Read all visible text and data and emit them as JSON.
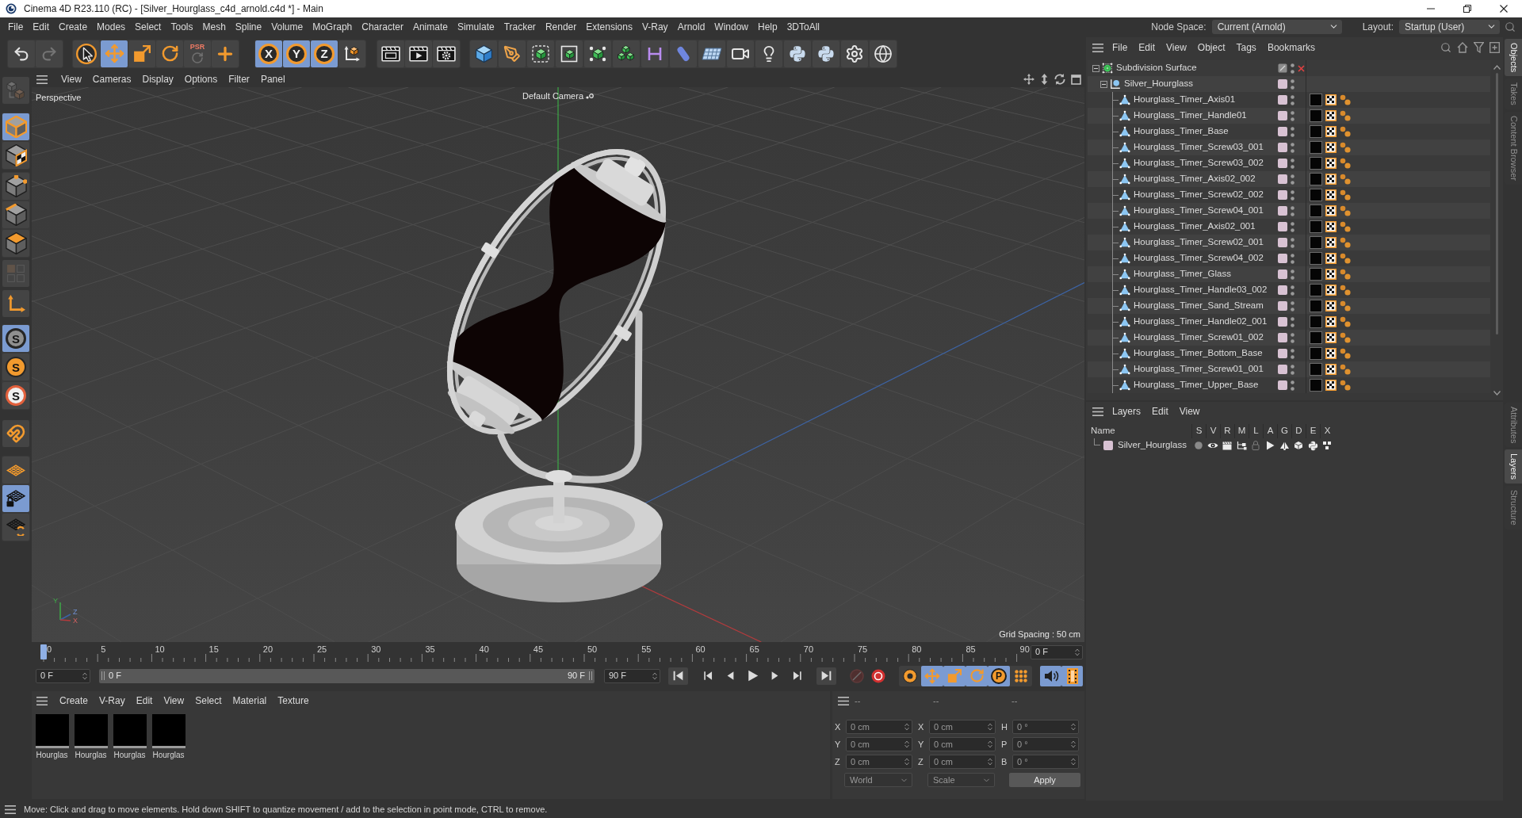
{
  "window": {
    "title": "Cinema 4D R23.110 (RC) - [Silver_Hourglass_c4d_arnold.c4d *] - Main"
  },
  "menu_bar": [
    "File",
    "Edit",
    "Create",
    "Modes",
    "Select",
    "Tools",
    "Mesh",
    "Spline",
    "Volume",
    "MoGraph",
    "Character",
    "Animate",
    "Simulate",
    "Tracker",
    "Render",
    "Extensions",
    "V-Ray",
    "Arnold",
    "Window",
    "Help",
    "3DToAll"
  ],
  "node_space": {
    "label": "Node Space:",
    "value": "Current (Arnold)"
  },
  "layout": {
    "label": "Layout:",
    "value": "Startup (User)"
  },
  "main_toolbar": [
    [
      {
        "active": false,
        "disabled": false
      },
      {
        "active": false,
        "disabled": true
      }
    ],
    [
      {
        "active": false,
        "disabled": false
      },
      {
        "active": true,
        "disabled": false
      },
      {
        "active": false,
        "disabled": false
      },
      {
        "active": false,
        "disabled": false
      },
      {
        "label": "PSR",
        "active": false,
        "disabled": true
      },
      {
        "active": false,
        "disabled": false
      }
    ],
    [
      {
        "label": "X",
        "active": true,
        "disabled": false
      },
      {
        "label": "Y",
        "active": true,
        "disabled": false
      },
      {
        "label": "Z",
        "active": true,
        "disabled": false
      },
      {
        "active": false,
        "disabled": false
      }
    ],
    [
      {
        "active": false,
        "disabled": false
      },
      {
        "active": false,
        "disabled": false
      },
      {
        "active": false,
        "disabled": false
      }
    ],
    [
      {
        "active": false,
        "disabled": false
      },
      {
        "active": false,
        "disabled": false
      },
      {
        "active": false,
        "disabled": false
      },
      {
        "active": false,
        "disabled": false
      },
      {
        "active": false,
        "disabled": false
      },
      {
        "active": false,
        "disabled": false
      },
      {
        "active": false,
        "disabled": false
      },
      {
        "active": false,
        "disabled": false
      },
      {
        "active": false,
        "disabled": false
      },
      {
        "active": false,
        "disabled": false
      },
      {
        "active": false,
        "disabled": false
      },
      {
        "active": false,
        "disabled": false
      },
      {
        "active": false,
        "disabled": false
      },
      {
        "active": false,
        "disabled": false
      },
      {
        "active": false,
        "disabled": false
      }
    ]
  ],
  "mode_toolbar": [
    [
      {
        "active": false,
        "disabled": true
      }
    ],
    [
      {
        "active": true,
        "disabled": false
      },
      {
        "active": false,
        "disabled": false
      }
    ],
    [
      {
        "active": false,
        "disabled": false
      },
      {
        "active": false,
        "disabled": false
      },
      {
        "active": false,
        "disabled": false
      }
    ],
    [
      {
        "active": false,
        "disabled": true
      }
    ],
    [
      {
        "active": false,
        "disabled": false
      }
    ],
    [
      {
        "label": "S",
        "active": true,
        "disabled": false
      },
      {
        "label": "S",
        "active": false,
        "disabled": false
      },
      {
        "label": "S",
        "active": false,
        "disabled": false
      }
    ],
    [
      {
        "active": false,
        "disabled": false
      }
    ],
    [
      {
        "active": false,
        "disabled": false
      },
      {
        "active": true,
        "disabled": false
      },
      {
        "active": false,
        "disabled": false
      }
    ]
  ],
  "viewport": {
    "menu": [
      "View",
      "Cameras",
      "Display",
      "Options",
      "Filter",
      "Panel"
    ],
    "view_name": "Perspective",
    "camera": "Default Camera",
    "grid_spacing": "Grid Spacing : 50 cm",
    "gizmo_labels": [
      "Y",
      "Z",
      "X"
    ]
  },
  "timeline": {
    "ruler_labels": [
      "0",
      "5",
      "10",
      "15",
      "20",
      "25",
      "30",
      "35",
      "40",
      "45",
      "50",
      "55",
      "60",
      "65",
      "70",
      "75",
      "80",
      "85",
      "90"
    ],
    "playhead": {
      "level": 0
    },
    "current_frame": "0 F",
    "start": "0 F",
    "range_start": "0 F",
    "range_end": "90 F",
    "end": "90 F",
    "record": [
      {
        "disabled": true
      },
      {
        "disabled": false
      }
    ],
    "key_tools": [
      {
        "active": false
      },
      {
        "active": true
      },
      {
        "active": true
      },
      {
        "active": true
      },
      {
        "label": "P",
        "active": true
      },
      {
        "active": false
      }
    ],
    "extras": [
      {
        "active": true
      },
      {
        "active": true
      }
    ]
  },
  "material_manager": {
    "menu": [
      "Create",
      "V-Ray",
      "Edit",
      "View",
      "Select",
      "Material",
      "Texture"
    ],
    "materials": [
      {
        "name": "Hourglas"
      },
      {
        "name": "Hourglas"
      },
      {
        "name": "Hourglas"
      },
      {
        "name": "Hourglas"
      }
    ]
  },
  "coordinates": {
    "disabled": true,
    "headers": [
      "--",
      "--",
      "--"
    ],
    "rows": [
      [
        {
          "axis": "X",
          "value": "0 cm"
        },
        {
          "axis": "X",
          "value": "0 cm"
        },
        {
          "axis": "H",
          "value": "0 °"
        }
      ],
      [
        {
          "axis": "Y",
          "value": "0 cm"
        },
        {
          "axis": "Y",
          "value": "0 cm"
        },
        {
          "axis": "P",
          "value": "0 °"
        }
      ],
      [
        {
          "axis": "Z",
          "value": "0 cm"
        },
        {
          "axis": "Z",
          "value": "0 cm"
        },
        {
          "axis": "B",
          "value": "0 °"
        }
      ]
    ],
    "dropdowns": [
      "World",
      "Scale"
    ],
    "apply": "Apply"
  },
  "object_manager": {
    "menu": [
      "File",
      "Edit",
      "View",
      "Object",
      "Tags",
      "Bookmarks"
    ],
    "objects": [
      {
        "name": "Subdivision Surface",
        "kind": "generator",
        "expanded": true,
        "enabled": false,
        "children": [
          {
            "name": "Silver_Hourglass",
            "kind": "group",
            "expanded": true,
            "color": "#d8c2d3",
            "children": [
              {
                "name": "Hourglass_Timer_Axis01",
                "kind": "mesh",
                "color": "#d8c2d3"
              },
              {
                "name": "Hourglass_Timer_Handle01",
                "kind": "mesh",
                "color": "#d8c2d3"
              },
              {
                "name": "Hourglass_Timer_Base",
                "kind": "mesh",
                "color": "#d8c2d3"
              },
              {
                "name": "Hourglass_Timer_Screw03_001",
                "kind": "mesh",
                "color": "#d8c2d3"
              },
              {
                "name": "Hourglass_Timer_Screw03_002",
                "kind": "mesh",
                "color": "#d8c2d3"
              },
              {
                "name": "Hourglass_Timer_Axis02_002",
                "kind": "mesh",
                "color": "#d8c2d3"
              },
              {
                "name": "Hourglass_Timer_Screw02_002",
                "kind": "mesh",
                "color": "#d8c2d3"
              },
              {
                "name": "Hourglass_Timer_Screw04_001",
                "kind": "mesh",
                "color": "#d8c2d3"
              },
              {
                "name": "Hourglass_Timer_Axis02_001",
                "kind": "mesh",
                "color": "#d8c2d3"
              },
              {
                "name": "Hourglass_Timer_Screw02_001",
                "kind": "mesh",
                "color": "#d8c2d3"
              },
              {
                "name": "Hourglass_Timer_Screw04_002",
                "kind": "mesh",
                "color": "#d8c2d3"
              },
              {
                "name": "Hourglass_Timer_Glass",
                "kind": "mesh",
                "color": "#d8c2d3"
              },
              {
                "name": "Hourglass_Timer_Handle03_002",
                "kind": "mesh",
                "color": "#d8c2d3"
              },
              {
                "name": "Hourglass_Timer_Sand_Stream",
                "kind": "mesh",
                "color": "#d8c2d3"
              },
              {
                "name": "Hourglass_Timer_Handle02_001",
                "kind": "mesh",
                "color": "#d8c2d3"
              },
              {
                "name": "Hourglass_Timer_Screw01_002",
                "kind": "mesh",
                "color": "#d8c2d3"
              },
              {
                "name": "Hourglass_Timer_Bottom_Base",
                "kind": "mesh",
                "color": "#d8c2d3"
              },
              {
                "name": "Hourglass_Timer_Screw01_001",
                "kind": "mesh",
                "color": "#d8c2d3"
              },
              {
                "name": "Hourglass_Timer_Upper_Base",
                "kind": "mesh",
                "color": "#d8c2d3"
              }
            ]
          }
        ]
      }
    ]
  },
  "layer_manager": {
    "menu": [
      "Layers",
      "Edit",
      "View"
    ],
    "columns": [
      "Name",
      "S",
      "V",
      "R",
      "M",
      "L",
      "A",
      "G",
      "D",
      "E",
      "X"
    ],
    "layers": [
      {
        "name": "Silver_Hourglass",
        "color": "#d8c2d3",
        "solo": false,
        "locked": false
      }
    ]
  },
  "side_tabs_top": [
    {
      "label": "Objects",
      "selected": true
    },
    {
      "label": "Takes",
      "selected": false
    },
    {
      "label": "Content Browser",
      "selected": false
    }
  ],
  "side_tabs_bottom": [
    {
      "label": "Attributes",
      "selected": false
    },
    {
      "label": "Layers",
      "selected": true
    },
    {
      "label": "Structure",
      "selected": false
    }
  ],
  "status_bar": "Move: Click and drag to move elements. Hold down SHIFT to quantize movement / add to the selection in point mode, CTRL to remove."
}
